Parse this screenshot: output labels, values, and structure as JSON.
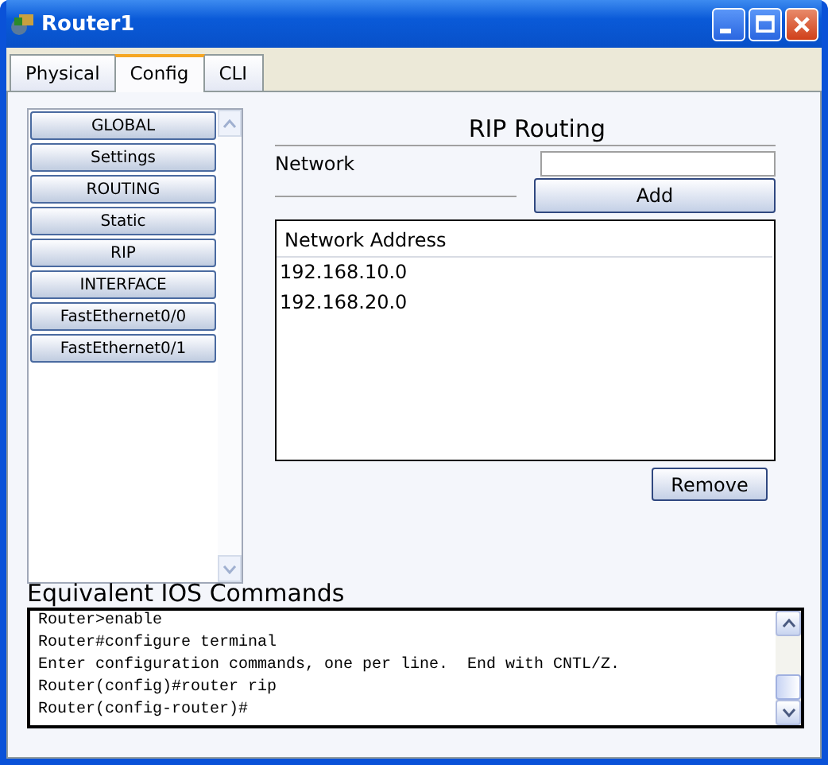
{
  "window": {
    "title": "Router1"
  },
  "tabs": [
    {
      "label": "Physical",
      "selected": false
    },
    {
      "label": "Config",
      "selected": true
    },
    {
      "label": "CLI",
      "selected": false
    }
  ],
  "sidebar": {
    "items": [
      {
        "label": "GLOBAL"
      },
      {
        "label": "Settings"
      },
      {
        "label": "ROUTING"
      },
      {
        "label": "Static"
      },
      {
        "label": "RIP"
      },
      {
        "label": "INTERFACE"
      },
      {
        "label": "FastEthernet0/0"
      },
      {
        "label": "FastEthernet0/1"
      }
    ]
  },
  "rip": {
    "title": "RIP Routing",
    "network_label": "Network",
    "add_button": "Add",
    "table": {
      "columns": [
        "Network Address"
      ],
      "rows": [
        "192.168.10.0",
        "192.168.20.0"
      ]
    },
    "remove_button": "Remove"
  },
  "console": {
    "title": "Equivalent IOS Commands",
    "lines": [
      "Router>enable",
      "Router#configure terminal",
      "Enter configuration commands, one per line.  End with CNTL/Z.",
      "Router(config)#router rip",
      "Router(config-router)#"
    ]
  }
}
